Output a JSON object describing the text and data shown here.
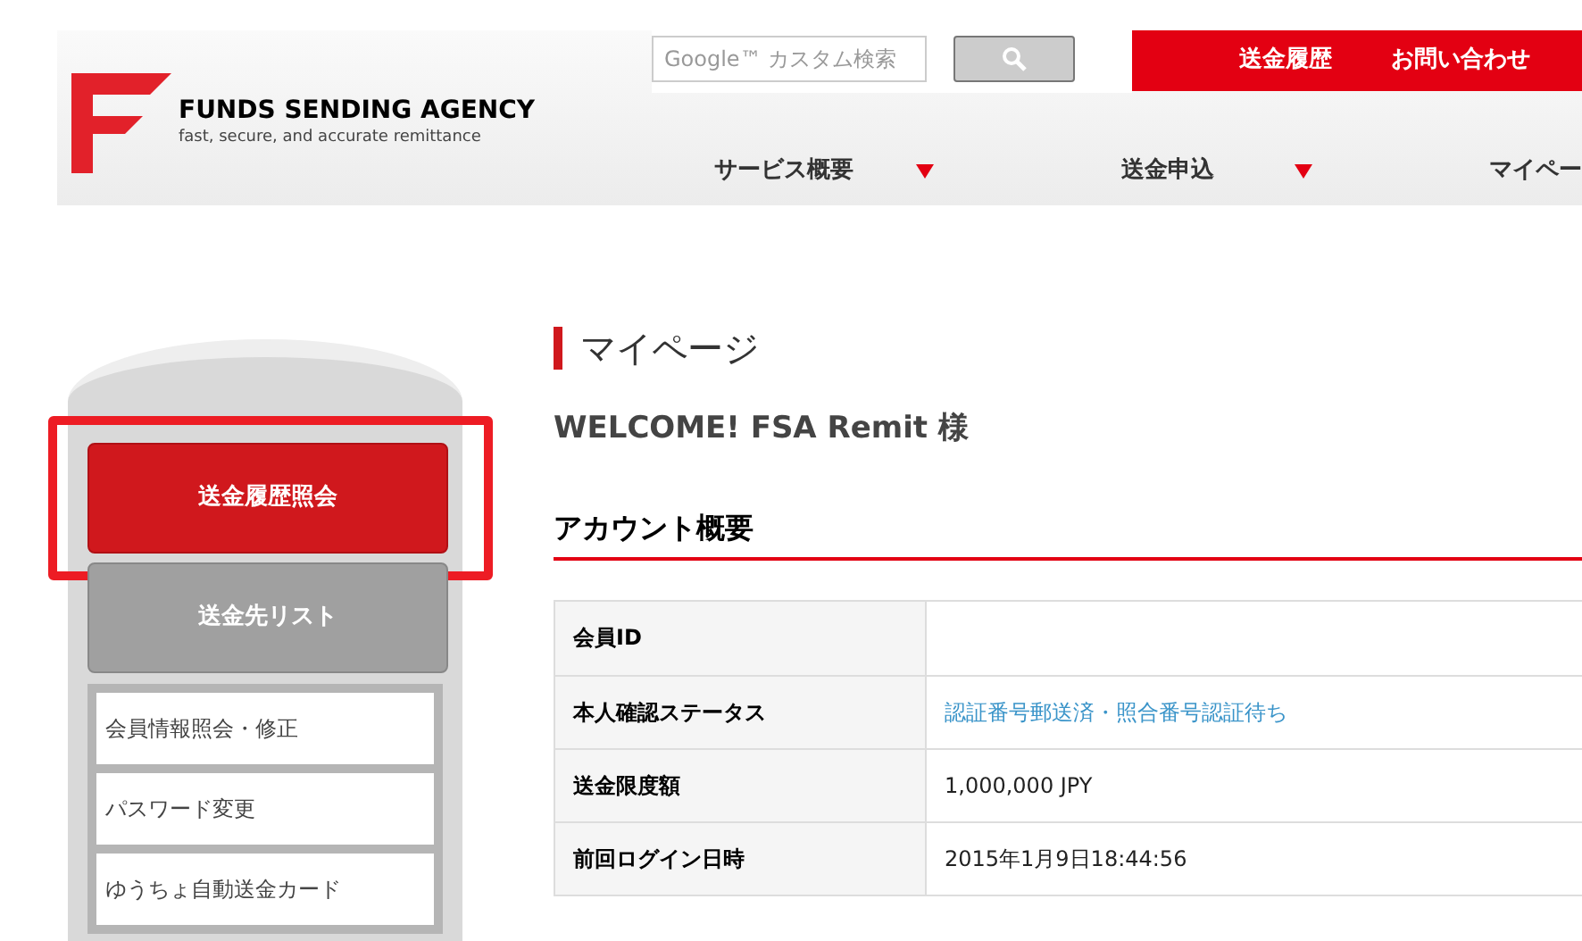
{
  "header": {
    "logo_name": "FUNDS SENDING AGENCY",
    "logo_tagline": "fast, secure, and accurate remittance",
    "search": {
      "placeholder": "Google™ カスタム検索"
    },
    "top_links": [
      "送金履歴",
      "お問い合わせ"
    ],
    "nav": [
      {
        "label": "サービス概要",
        "has_dropdown": true
      },
      {
        "label": "送金申込",
        "has_dropdown": true
      },
      {
        "label": "マイペー",
        "has_dropdown": false
      }
    ]
  },
  "sidebar": {
    "buttons": [
      {
        "label": "送金履歴照会",
        "selected": true,
        "highlighted": true
      },
      {
        "label": "送金先リスト",
        "selected": false,
        "highlighted": false
      }
    ],
    "links": [
      "会員情報照会・修正",
      "パスワード変更",
      "ゆうちょ自動送金カード"
    ]
  },
  "main": {
    "title": "マイページ",
    "welcome": "WELCOME! FSA Remit 様",
    "section": "アカウント概要",
    "rows": [
      {
        "label": "会員ID"
      },
      {
        "label": "本人確認ステータス",
        "value": "認証番号郵送済・照合番号認証待ち",
        "kind": "link"
      },
      {
        "label": "送金限度額",
        "value": "1,000,000 JPY",
        "kind": "text"
      },
      {
        "label": "前回ログイン日時",
        "value": "2015年1月9日18:44:56",
        "kind": "text"
      }
    ]
  }
}
